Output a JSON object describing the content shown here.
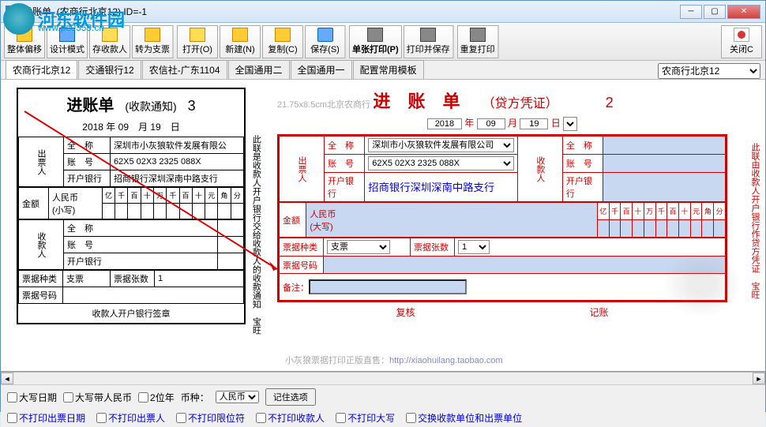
{
  "window": {
    "title": "进账单_(农商行北京12)  ID=-1"
  },
  "watermark": {
    "text": "河东软件园",
    "url": "www.pc0359.cn"
  },
  "toolbar": {
    "btn_offset": "整体偏移",
    "btn_design": "设计模式",
    "btn_saverecv": "存收款人",
    "btn_tocheck": "转为支票",
    "btn_open": "打开(O)",
    "btn_new": "新建(N)",
    "btn_copy": "复制(C)",
    "btn_save": "保存(S)",
    "btn_printone": "单张打印(P)",
    "btn_printsave": "打印并保存",
    "btn_reprint": "重复打印",
    "btn_close": "关闭C"
  },
  "tabs": {
    "t1": "农商行北京12",
    "t2": "交通银行12",
    "t3": "农信社-广东1104",
    "t4": "全国通用二",
    "t5": "全国通用一",
    "t6": "配置常用模板",
    "selector": "农商行北京12"
  },
  "left_form": {
    "title": "进账单",
    "subtitle": "(收款通知)",
    "num": "3",
    "year": "2018",
    "month": "09",
    "day": "19",
    "payer_label": "出票人",
    "fullname_label": "全　称",
    "account_label": "账　号",
    "bank_label": "开户银行",
    "fullname": "深圳市小灰狼软件发展有限公",
    "account": "62X5 02X3 2325 088X",
    "bank": "招商银行深圳深南中路支行",
    "amount_label": "金额",
    "rmb_label": "人民币",
    "small_label": "(小写)",
    "digits": "亿千百十万千百十元角分",
    "payee_label": "收款人",
    "type_label": "票据种类",
    "type_value": "支票",
    "count_label": "票据张数",
    "count_value": "1",
    "billno_label": "票据号码",
    "signature": "收款人开户银行签章",
    "side_note": "此联是收款人开户银行交给收款人的收款通知　宝旺"
  },
  "right_form": {
    "dim_text": "21.75x8.5cm北京农商行",
    "title": "进 账 单",
    "subtitle": "（贷方凭证）",
    "num": "2",
    "year": "2018",
    "month": "09",
    "day": "19",
    "y_lbl": "年",
    "m_lbl": "月",
    "d_lbl": "日",
    "payer_label": "出票人",
    "payee_label": "收款人",
    "fullname_label": "全　称",
    "account_label": "账　号",
    "bank_label": "开户银行",
    "fullname": "深圳市小灰狼软件发展有限公司",
    "account": "62X5 02X3 2325 088X",
    "bank": "招商银行深圳深南中路支行",
    "amount_label": "金额",
    "rmb_label": "人民币",
    "big_label": "(大写)",
    "digits": "亿千百十万千百十元角分",
    "type_label": "票据种类",
    "type_value": "支票",
    "count_label": "票据张数",
    "count_value": "1",
    "billno_label": "票据号码",
    "remark_label": "备注：",
    "review_label": "复核",
    "account_chk_label": "记账",
    "side_note": "此联由收款人开户银行作贷方凭证　宝旺"
  },
  "footer_link": {
    "text": "小灰狼票据打印正版直售：",
    "url": "http://xiaohuilang.taobao.com"
  },
  "options1": {
    "cb1": "大写日期",
    "cb2": "大写带人民币",
    "cb3": "2位年",
    "currency_label": "币种：",
    "currency": "人民币",
    "remember": "记住选项"
  },
  "options2": {
    "cb1": "不打印出票日期",
    "cb2": "不打印出票人",
    "cb3": "不打印限位符",
    "cb4": "不打印收款人",
    "cb5": "不打印大写",
    "cb6": "交换收款单位和出票单位"
  }
}
